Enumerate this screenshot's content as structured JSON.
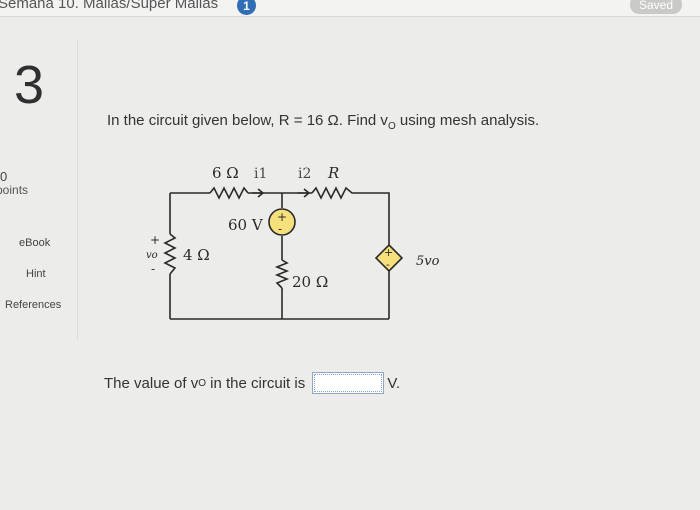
{
  "header": {
    "breadcrumb": "Semana 10. Mallas/Super Mallas",
    "badge_count": "1",
    "saved_label": "Saved"
  },
  "sidebar": {
    "question_number": "3",
    "points_value": "0",
    "points_label": "points",
    "links": [
      {
        "label": "eBook"
      },
      {
        "label": "Hint"
      },
      {
        "label": "References"
      }
    ]
  },
  "question": {
    "text": "In the circuit given below, R = 16 Ω. Find v",
    "subscript": "O",
    "text_suffix": " using mesh analysis."
  },
  "circuit": {
    "r_top": "6 Ω",
    "i1": "i1",
    "i2": "i2",
    "r_label": "R",
    "source_label": "60 V",
    "r_left": "4 Ω",
    "r_mid": "20 Ω",
    "vo_label": "vo",
    "dep_source_label": "5vo",
    "colors": {
      "wire": "#2a2a2a",
      "source_fill": "#f6e07b"
    }
  },
  "answer": {
    "prefix": "The value of v",
    "subscript": "O",
    "middle": " in the circuit is ",
    "value": "",
    "unit": "V."
  }
}
